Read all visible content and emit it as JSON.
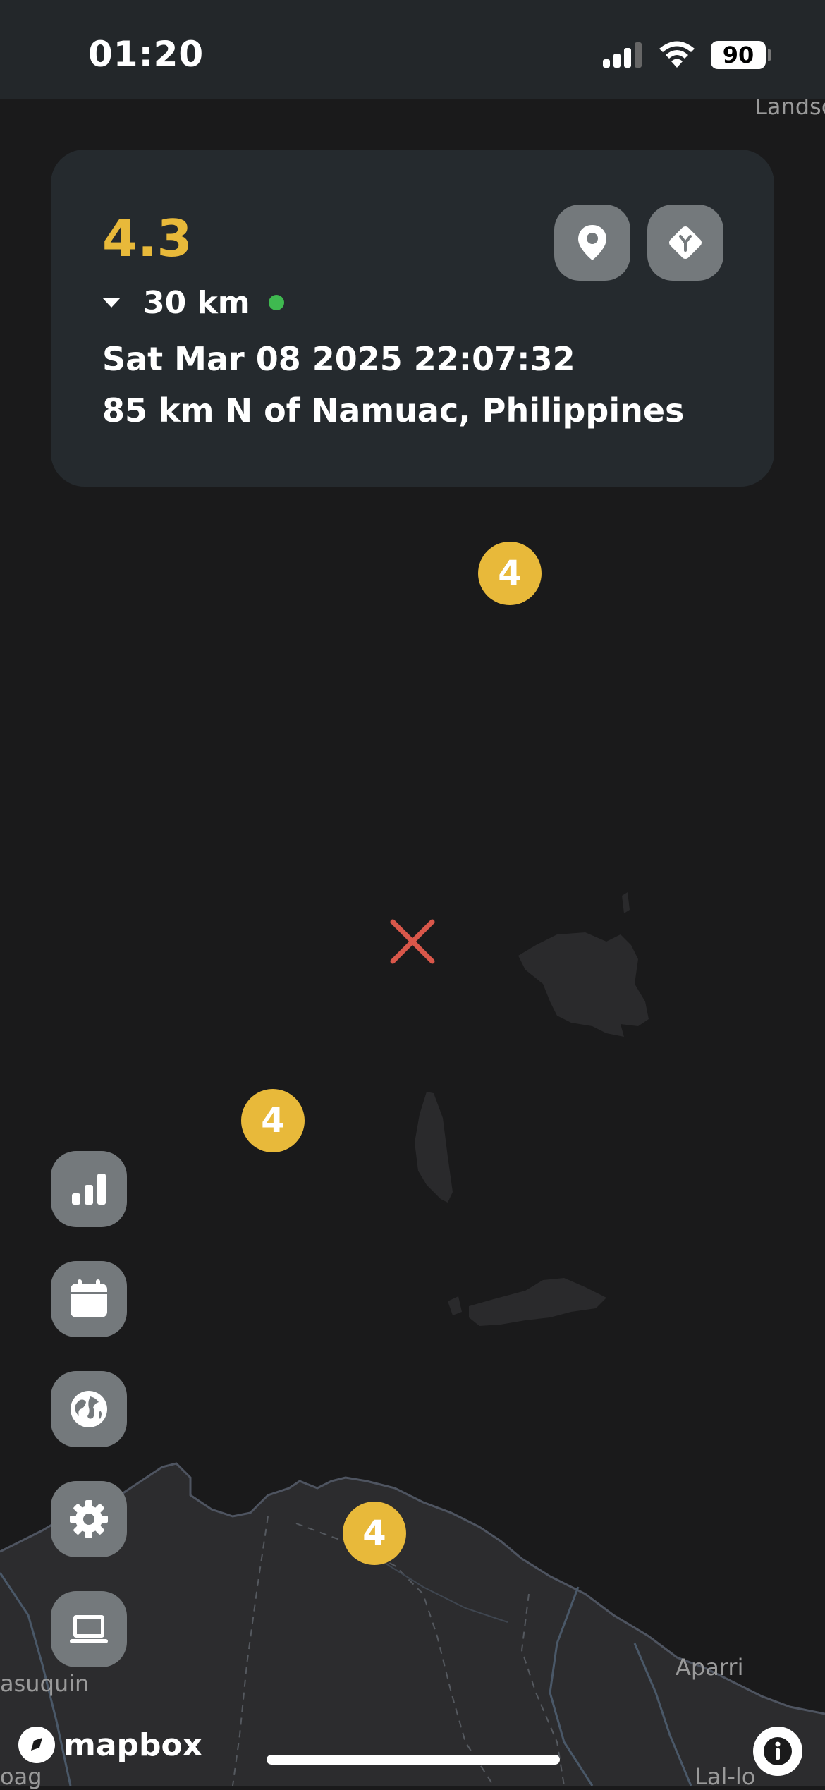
{
  "status_bar": {
    "time": "01:20",
    "battery": "90"
  },
  "quake": {
    "magnitude": "4.3",
    "depth": "30 km",
    "datetime": "Sat Mar 08 2025 22:07:32",
    "location": "85 km N of Namuac, Philippines"
  },
  "clusters": [
    {
      "count": "4"
    },
    {
      "count": "4"
    },
    {
      "count": "4"
    }
  ],
  "map_labels": {
    "top_right": "Landsc",
    "pasuquin": "asuquin",
    "aparri": "Aparri",
    "laoag": "oag",
    "lal_lo": "Lal-lo"
  },
  "attribution": {
    "logo_text": "mapbox"
  },
  "colors": {
    "magnitude": "#e8b93a",
    "cluster": "#e8b93a",
    "epicenter": "#d9574a",
    "live_dot": "#3fb950"
  },
  "icons": {
    "card_buttons": [
      "map-pin-icon",
      "directions-icon"
    ],
    "side_buttons": [
      "chart-icon",
      "calendar-icon",
      "globe-icon",
      "gear-icon",
      "laptop-icon"
    ]
  }
}
